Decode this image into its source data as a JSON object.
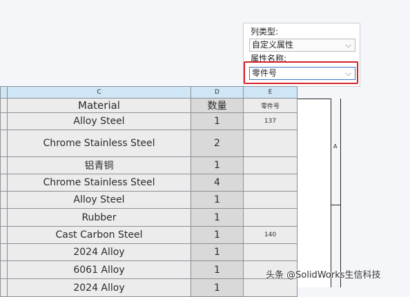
{
  "popup": {
    "column_type_label": "列类型:",
    "column_type_value": "自定义属性",
    "property_name_label": "属性名称:",
    "property_name_value": "零件号"
  },
  "table": {
    "col_letters": [
      "C",
      "D",
      "E"
    ],
    "headers": {
      "material": "Material",
      "qty": "数量",
      "part_no": "零件号"
    },
    "rows": [
      {
        "material": "Alloy Steel",
        "qty": "1",
        "part_no": "137"
      },
      {
        "material": "Chrome Stainless Steel",
        "qty": "2",
        "part_no": ""
      },
      {
        "material": "铝青铜",
        "qty": "1",
        "part_no": ""
      },
      {
        "material": "Chrome Stainless Steel",
        "qty": "4",
        "part_no": ""
      },
      {
        "material": "Alloy Steel",
        "qty": "1",
        "part_no": ""
      },
      {
        "material": "Rubber",
        "qty": "1",
        "part_no": ""
      },
      {
        "material": "Cast Carbon Steel",
        "qty": "1",
        "part_no": "140"
      },
      {
        "material": "2024 Alloy",
        "qty": "1",
        "part_no": ""
      },
      {
        "material": "6061 Alloy",
        "qty": "1",
        "part_no": ""
      },
      {
        "material": "2024 Alloy",
        "qty": "1",
        "part_no": ""
      }
    ]
  },
  "frame": {
    "zone_label": "A"
  },
  "watermark": "头条 @SolidWorks生信科技"
}
